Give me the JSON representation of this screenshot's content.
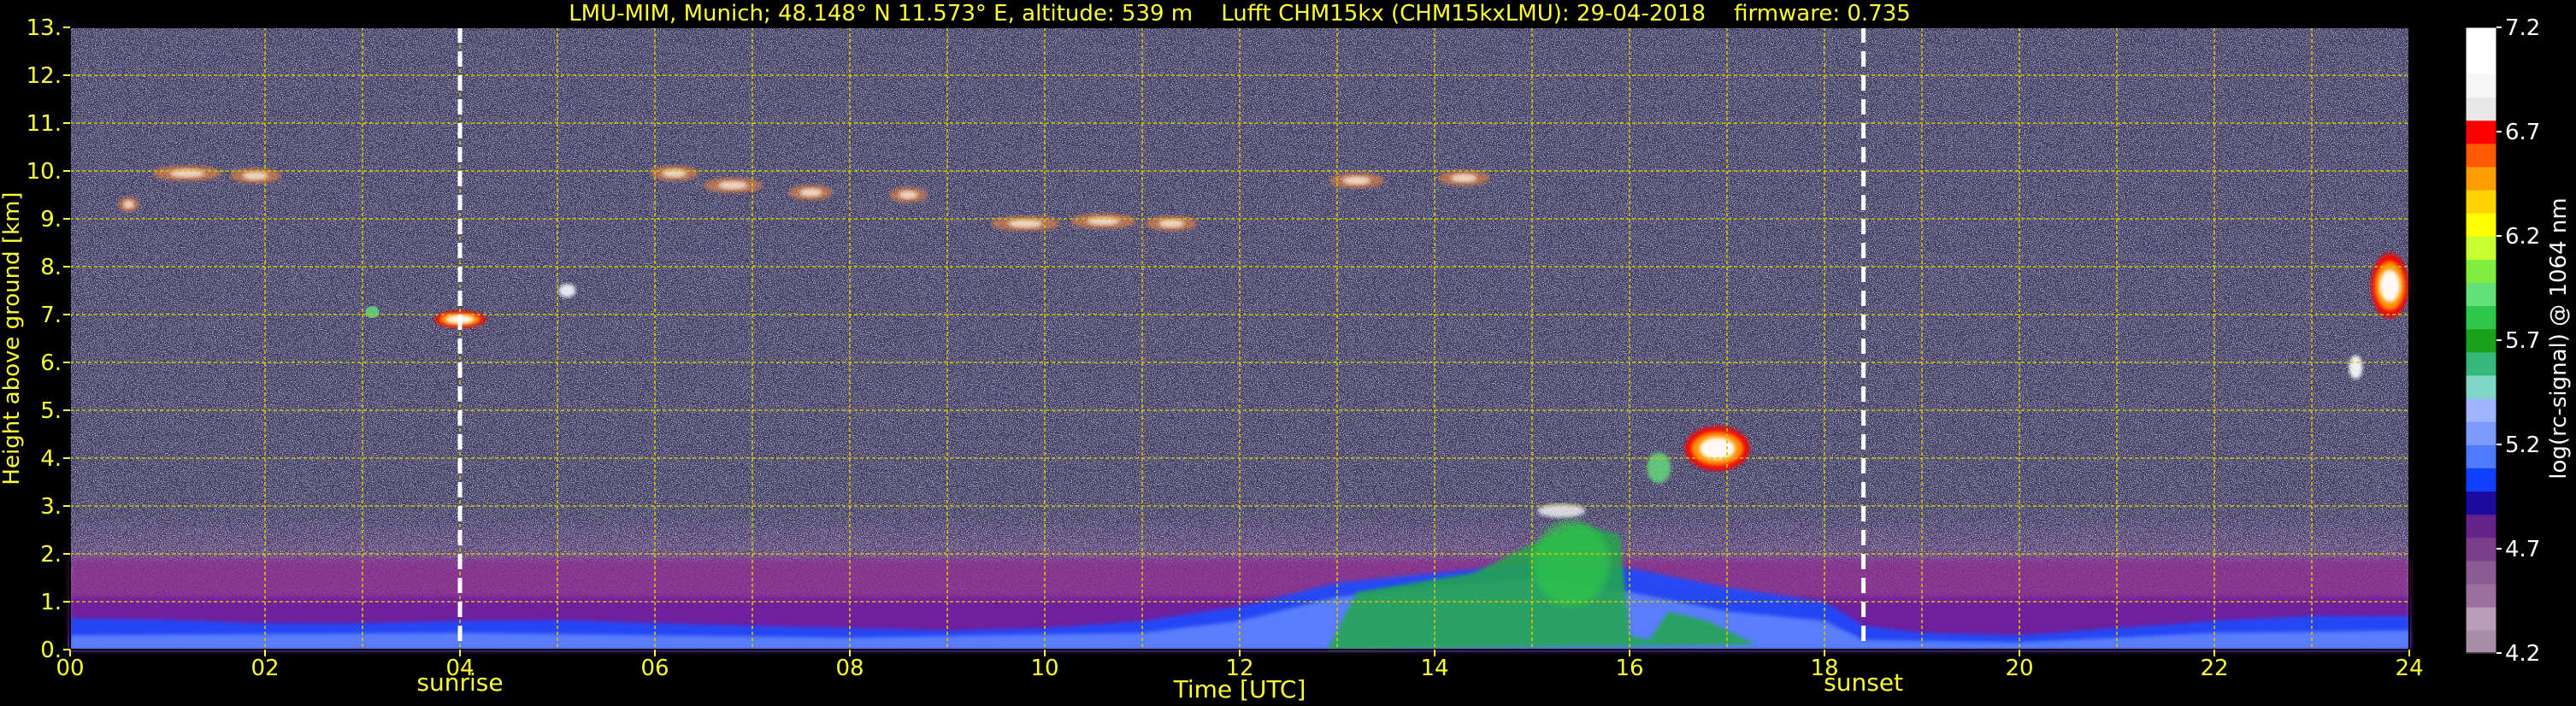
{
  "chart_data": {
    "type": "heatmap",
    "title": "LMU-MIM, Munich; 48.148° N 11.573° E, altitude: 539 m    Lufft CHM15kx (CHM15kxLMU): 29-04-2018    firmware: 0.735",
    "xlabel": "Time [UTC]",
    "ylabel": "Height above ground [km]",
    "xlim": [
      0,
      24
    ],
    "ylim": [
      0,
      13
    ],
    "x_ticks": [
      "00",
      "02",
      "04",
      "06",
      "08",
      "10",
      "12",
      "14",
      "16",
      "18",
      "20",
      "22",
      "24"
    ],
    "y_ticks": [
      "0.",
      "1.",
      "2.",
      "3.",
      "4.",
      "5.",
      "6.",
      "7.",
      "8.",
      "9.",
      "10.",
      "11.",
      "12.",
      "13."
    ],
    "grid": true,
    "colorbar": {
      "label": "log(rc-signal) @ 1064 nm",
      "range": [
        4.2,
        7.2
      ],
      "ticks": [
        "4.2",
        "4.7",
        "5.2",
        "5.7",
        "6.2",
        "6.7",
        "7.2"
      ],
      "colors": [
        "#a88fa8",
        "#b89cb8",
        "#9a6f9e",
        "#8c5a94",
        "#7a3f8a",
        "#65228a",
        "#1a0a9e",
        "#1040ff",
        "#4d7aff",
        "#7e9cff",
        "#9fb5ff",
        "#7fd6c6",
        "#36b87c",
        "#1aa01a",
        "#2ec84a",
        "#64e07a",
        "#7fee40",
        "#c8ff32",
        "#ffff00",
        "#ffd100",
        "#ff9c00",
        "#ff5a00",
        "#ff0000",
        "#e8e8e8",
        "#f6f6f6",
        "#ffffff",
        "#ffffff"
      ]
    },
    "markers": [
      {
        "label": "sunrise",
        "x": 4.0
      },
      {
        "label": "sunset",
        "x": 18.4
      }
    ],
    "features": [
      {
        "name": "boundary-layer",
        "x_range": [
          0,
          24
        ],
        "height_range": [
          0,
          1.9
        ]
      },
      {
        "name": "cloud-16-17",
        "x_range": [
          16.0,
          17.3
        ],
        "height_range": [
          3.5,
          5.0
        ]
      },
      {
        "name": "cirrus-7km",
        "x_range": [
          3.3,
          4.5
        ],
        "height_range": [
          6.7,
          7.2
        ]
      },
      {
        "name": "cirrus-9-10km",
        "x_range": [
          6.0,
          11.3
        ],
        "height_range": [
          8.5,
          10.2
        ]
      },
      {
        "name": "cloud-24",
        "x_range": [
          23.5,
          24.0
        ],
        "height_range": [
          6.8,
          8.8
        ]
      }
    ]
  }
}
